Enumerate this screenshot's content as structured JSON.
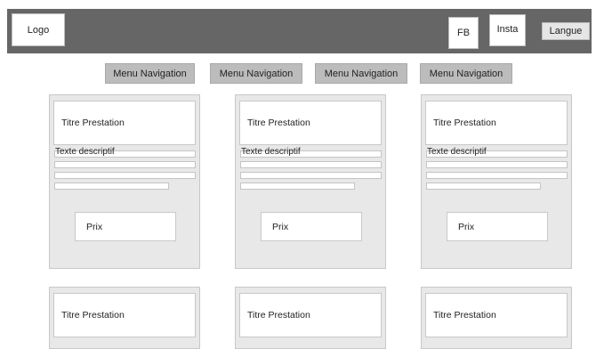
{
  "header": {
    "logo": "Logo",
    "fb": "FB",
    "insta": "Insta",
    "langue": "Langue"
  },
  "nav": {
    "items": [
      "Menu Navigation",
      "Menu Navigation",
      "Menu Navigation",
      "Menu Navigation"
    ]
  },
  "cards": [
    {
      "title": "Titre Prestation",
      "description": "Texte descriptif",
      "price": "Prix"
    },
    {
      "title": "Titre Prestation",
      "description": "Texte descriptif",
      "price": "Prix"
    },
    {
      "title": "Titre Prestation",
      "description": "Texte descriptif",
      "price": "Prix"
    },
    {
      "title": "Titre Prestation"
    },
    {
      "title": "Titre Prestation"
    },
    {
      "title": "Titre Prestation"
    }
  ]
}
